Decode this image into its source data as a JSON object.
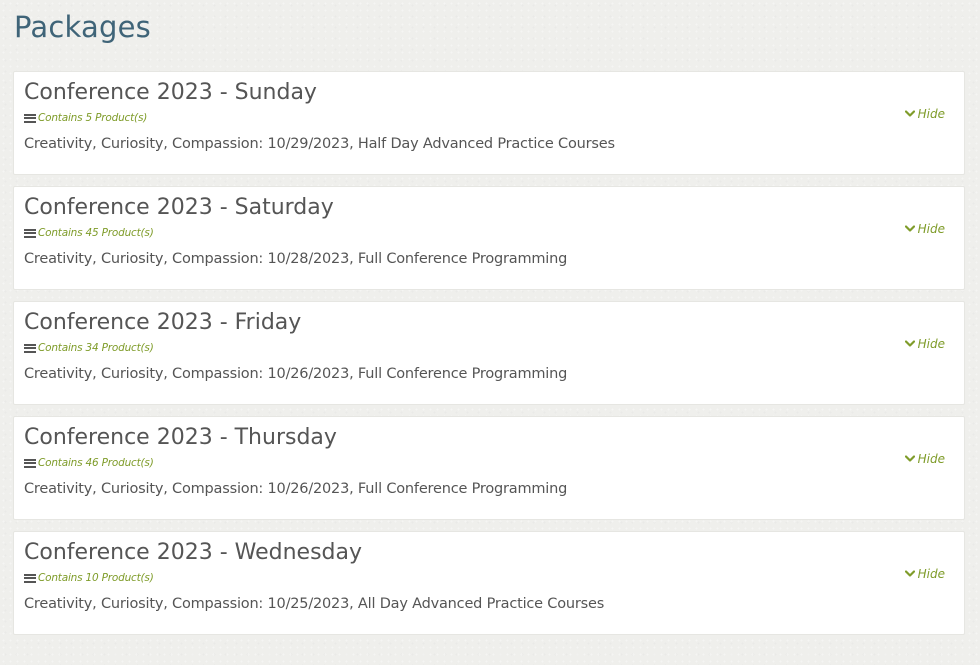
{
  "page": {
    "title": "Packages"
  },
  "packages": [
    {
      "title": "Conference 2023 - Sunday",
      "product_count": "Contains 5 Product(s)",
      "description": "Creativity, Curiosity, Compassion: 10/29/2023, Half Day Advanced Practice Courses",
      "toggle_label": "Hide"
    },
    {
      "title": "Conference 2023 - Saturday",
      "product_count": "Contains 45 Product(s)",
      "description": "Creativity, Curiosity, Compassion: 10/28/2023, Full Conference Programming",
      "toggle_label": "Hide"
    },
    {
      "title": "Conference 2023 - Friday",
      "product_count": "Contains 34 Product(s)",
      "description": "Creativity, Curiosity, Compassion: 10/26/2023, Full Conference Programming",
      "toggle_label": "Hide"
    },
    {
      "title": "Conference 2023 - Thursday",
      "product_count": "Contains 46 Product(s)",
      "description": "Creativity, Curiosity, Compassion: 10/26/2023, Full Conference Programming",
      "toggle_label": "Hide"
    },
    {
      "title": "Conference 2023 - Wednesday",
      "product_count": "Contains 10 Product(s)",
      "description": "Creativity, Curiosity, Compassion: 10/25/2023, All Day Advanced Practice Courses",
      "toggle_label": "Hide"
    }
  ],
  "icons": {
    "product_count": "list-icon",
    "toggle": "chevron-down-icon"
  },
  "colors": {
    "heading": "#3f6478",
    "accent": "#7f9c2a",
    "text": "#555555",
    "background": "#efefec",
    "card": "#ffffff"
  }
}
